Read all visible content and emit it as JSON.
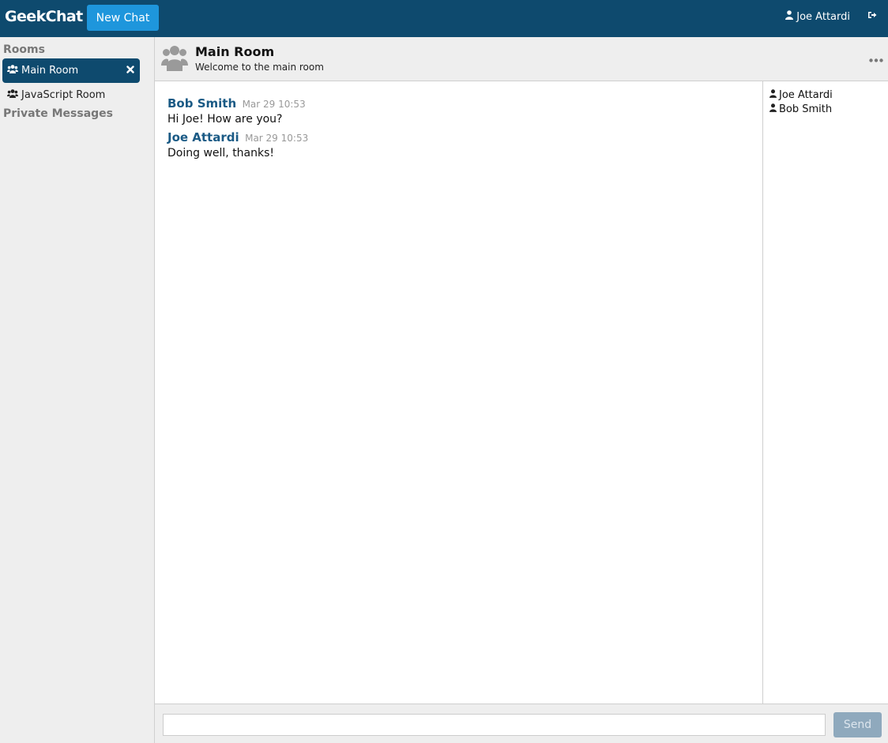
{
  "app": {
    "brand": "GeekChat",
    "new_chat_label": "New Chat"
  },
  "user": {
    "name": "Joe Attardi"
  },
  "sidebar": {
    "rooms_title": "Rooms",
    "rooms": [
      {
        "name": "Main Room",
        "active": true
      },
      {
        "name": "JavaScript Room",
        "active": false
      }
    ],
    "private_title": "Private Messages"
  },
  "room": {
    "title": "Main Room",
    "welcome": "Welcome to the main room"
  },
  "messages": [
    {
      "author": "Bob Smith",
      "time": "Mar 29 10:53",
      "text": "Hi Joe! How are you?"
    },
    {
      "author": "Joe Attardi",
      "time": "Mar 29 10:53",
      "text": "Doing well, thanks!"
    }
  ],
  "members": [
    "Joe Attardi",
    "Bob Smith"
  ],
  "composer": {
    "value": "",
    "send_label": "Send"
  },
  "colors": {
    "topbar": "#0e4a6e",
    "accent": "#1e96dc",
    "author": "#1a5a85"
  },
  "icons": {
    "room": "group-icon",
    "member": "user-icon",
    "logout": "logout-icon",
    "close": "close-icon",
    "more": "more-icon"
  }
}
